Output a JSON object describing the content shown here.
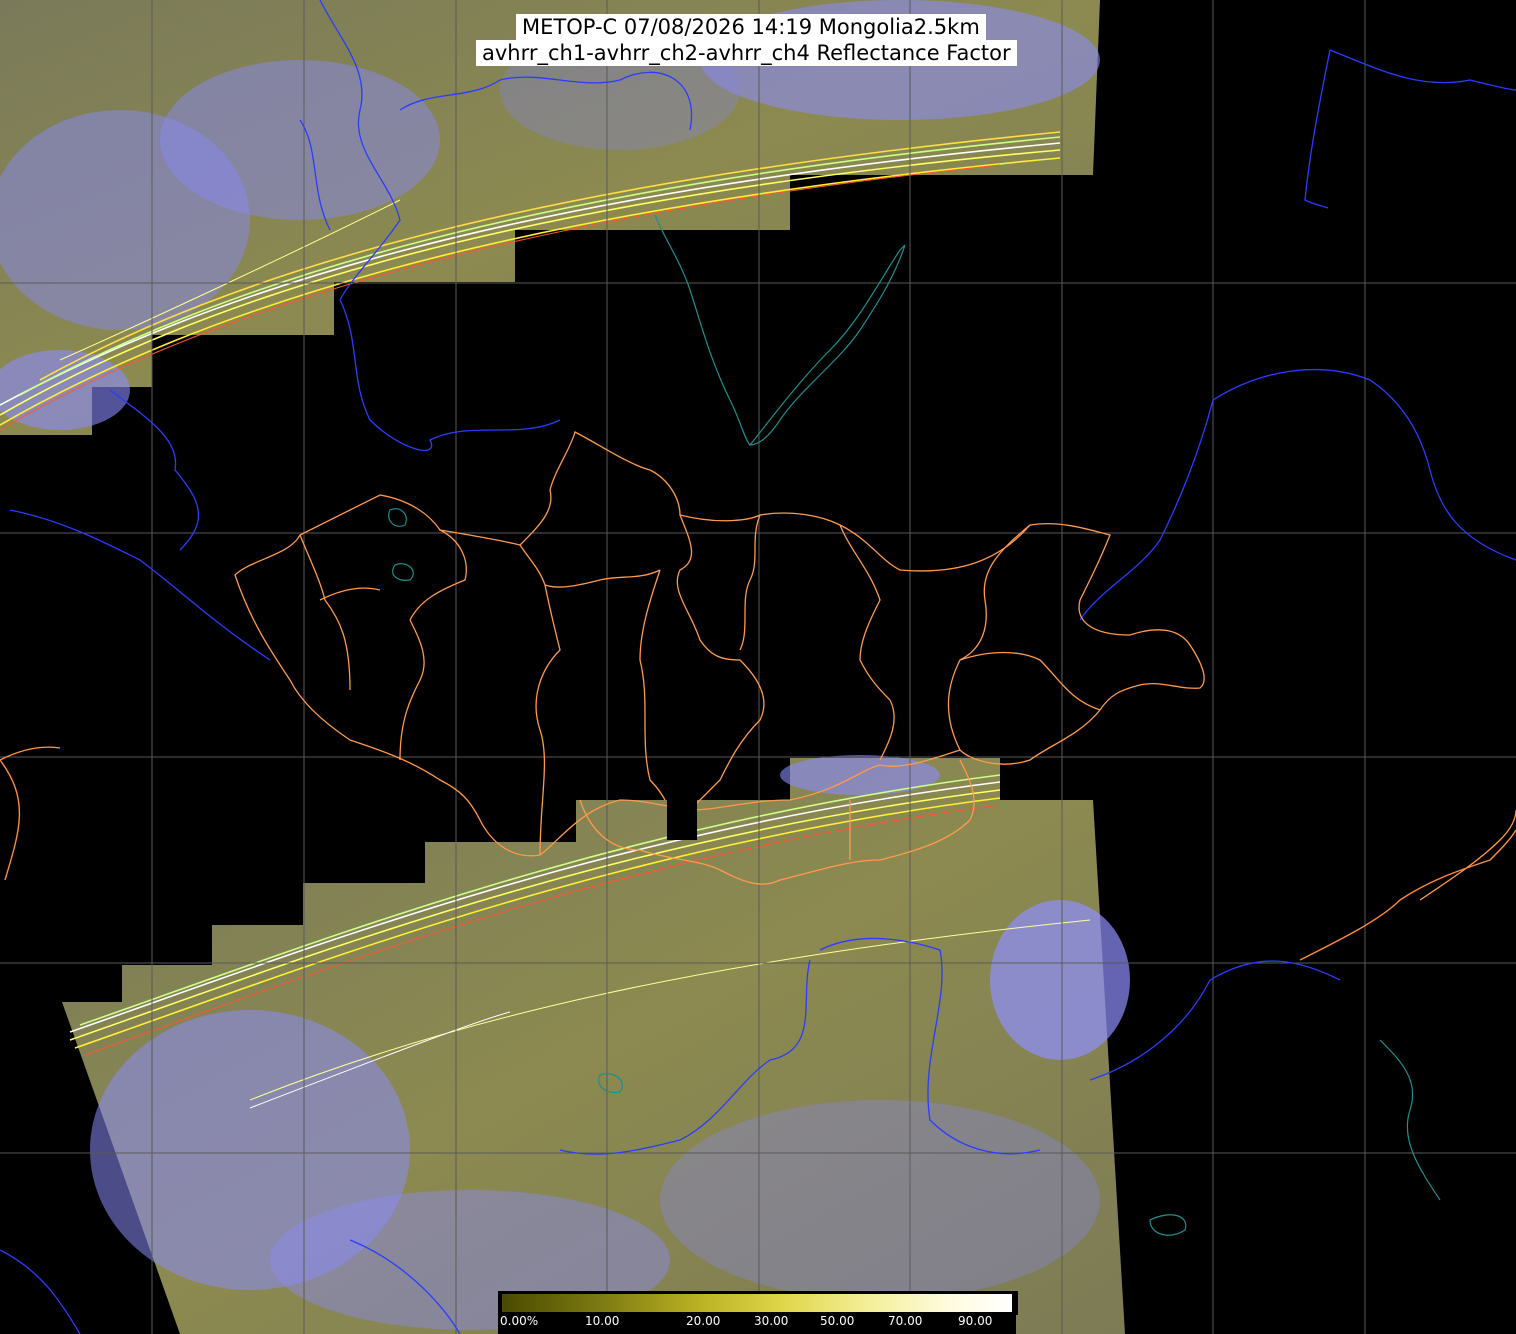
{
  "title": {
    "line1": "METOP-C 07/08/2026 14:19 Mongolia2.5km",
    "line2": "avhrr_ch1-avhrr_ch2-avhrr_ch4 Reflectance Factor"
  },
  "colorbar": {
    "ticks": [
      "0.00%",
      "10.00",
      "20.00",
      "30.00",
      "50.00",
      "70.00",
      "90.00"
    ]
  },
  "colors": {
    "background": "#000000",
    "swath_ground": "#8a8a5a",
    "cloud": "#8888ff",
    "grid": "#555555",
    "country_border": "#ff9944",
    "river_coast": "#2244ff",
    "lake": "#1a8a8a"
  }
}
